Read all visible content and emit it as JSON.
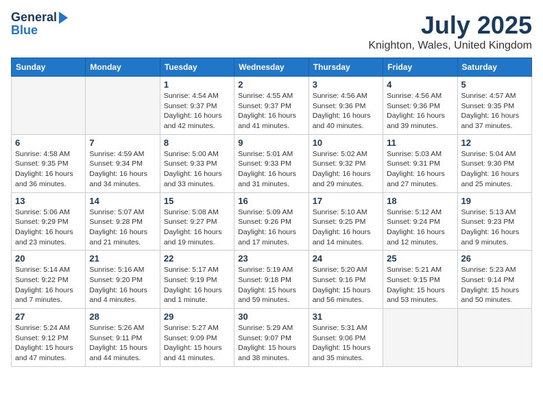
{
  "header": {
    "logo_line1": "General",
    "logo_line2": "Blue",
    "month": "July 2025",
    "location": "Knighton, Wales, United Kingdom"
  },
  "weekdays": [
    "Sunday",
    "Monday",
    "Tuesday",
    "Wednesday",
    "Thursday",
    "Friday",
    "Saturday"
  ],
  "weeks": [
    [
      {
        "day": "",
        "sunrise": "",
        "sunset": "",
        "daylight": ""
      },
      {
        "day": "",
        "sunrise": "",
        "sunset": "",
        "daylight": ""
      },
      {
        "day": "1",
        "sunrise": "Sunrise: 4:54 AM",
        "sunset": "Sunset: 9:37 PM",
        "daylight": "Daylight: 16 hours and 42 minutes."
      },
      {
        "day": "2",
        "sunrise": "Sunrise: 4:55 AM",
        "sunset": "Sunset: 9:37 PM",
        "daylight": "Daylight: 16 hours and 41 minutes."
      },
      {
        "day": "3",
        "sunrise": "Sunrise: 4:56 AM",
        "sunset": "Sunset: 9:36 PM",
        "daylight": "Daylight: 16 hours and 40 minutes."
      },
      {
        "day": "4",
        "sunrise": "Sunrise: 4:56 AM",
        "sunset": "Sunset: 9:36 PM",
        "daylight": "Daylight: 16 hours and 39 minutes."
      },
      {
        "day": "5",
        "sunrise": "Sunrise: 4:57 AM",
        "sunset": "Sunset: 9:35 PM",
        "daylight": "Daylight: 16 hours and 37 minutes."
      }
    ],
    [
      {
        "day": "6",
        "sunrise": "Sunrise: 4:58 AM",
        "sunset": "Sunset: 9:35 PM",
        "daylight": "Daylight: 16 hours and 36 minutes."
      },
      {
        "day": "7",
        "sunrise": "Sunrise: 4:59 AM",
        "sunset": "Sunset: 9:34 PM",
        "daylight": "Daylight: 16 hours and 34 minutes."
      },
      {
        "day": "8",
        "sunrise": "Sunrise: 5:00 AM",
        "sunset": "Sunset: 9:33 PM",
        "daylight": "Daylight: 16 hours and 33 minutes."
      },
      {
        "day": "9",
        "sunrise": "Sunrise: 5:01 AM",
        "sunset": "Sunset: 9:33 PM",
        "daylight": "Daylight: 16 hours and 31 minutes."
      },
      {
        "day": "10",
        "sunrise": "Sunrise: 5:02 AM",
        "sunset": "Sunset: 9:32 PM",
        "daylight": "Daylight: 16 hours and 29 minutes."
      },
      {
        "day": "11",
        "sunrise": "Sunrise: 5:03 AM",
        "sunset": "Sunset: 9:31 PM",
        "daylight": "Daylight: 16 hours and 27 minutes."
      },
      {
        "day": "12",
        "sunrise": "Sunrise: 5:04 AM",
        "sunset": "Sunset: 9:30 PM",
        "daylight": "Daylight: 16 hours and 25 minutes."
      }
    ],
    [
      {
        "day": "13",
        "sunrise": "Sunrise: 5:06 AM",
        "sunset": "Sunset: 9:29 PM",
        "daylight": "Daylight: 16 hours and 23 minutes."
      },
      {
        "day": "14",
        "sunrise": "Sunrise: 5:07 AM",
        "sunset": "Sunset: 9:28 PM",
        "daylight": "Daylight: 16 hours and 21 minutes."
      },
      {
        "day": "15",
        "sunrise": "Sunrise: 5:08 AM",
        "sunset": "Sunset: 9:27 PM",
        "daylight": "Daylight: 16 hours and 19 minutes."
      },
      {
        "day": "16",
        "sunrise": "Sunrise: 5:09 AM",
        "sunset": "Sunset: 9:26 PM",
        "daylight": "Daylight: 16 hours and 17 minutes."
      },
      {
        "day": "17",
        "sunrise": "Sunrise: 5:10 AM",
        "sunset": "Sunset: 9:25 PM",
        "daylight": "Daylight: 16 hours and 14 minutes."
      },
      {
        "day": "18",
        "sunrise": "Sunrise: 5:12 AM",
        "sunset": "Sunset: 9:24 PM",
        "daylight": "Daylight: 16 hours and 12 minutes."
      },
      {
        "day": "19",
        "sunrise": "Sunrise: 5:13 AM",
        "sunset": "Sunset: 9:23 PM",
        "daylight": "Daylight: 16 hours and 9 minutes."
      }
    ],
    [
      {
        "day": "20",
        "sunrise": "Sunrise: 5:14 AM",
        "sunset": "Sunset: 9:22 PM",
        "daylight": "Daylight: 16 hours and 7 minutes."
      },
      {
        "day": "21",
        "sunrise": "Sunrise: 5:16 AM",
        "sunset": "Sunset: 9:20 PM",
        "daylight": "Daylight: 16 hours and 4 minutes."
      },
      {
        "day": "22",
        "sunrise": "Sunrise: 5:17 AM",
        "sunset": "Sunset: 9:19 PM",
        "daylight": "Daylight: 16 hours and 1 minute."
      },
      {
        "day": "23",
        "sunrise": "Sunrise: 5:19 AM",
        "sunset": "Sunset: 9:18 PM",
        "daylight": "Daylight: 15 hours and 59 minutes."
      },
      {
        "day": "24",
        "sunrise": "Sunrise: 5:20 AM",
        "sunset": "Sunset: 9:16 PM",
        "daylight": "Daylight: 15 hours and 56 minutes."
      },
      {
        "day": "25",
        "sunrise": "Sunrise: 5:21 AM",
        "sunset": "Sunset: 9:15 PM",
        "daylight": "Daylight: 15 hours and 53 minutes."
      },
      {
        "day": "26",
        "sunrise": "Sunrise: 5:23 AM",
        "sunset": "Sunset: 9:14 PM",
        "daylight": "Daylight: 15 hours and 50 minutes."
      }
    ],
    [
      {
        "day": "27",
        "sunrise": "Sunrise: 5:24 AM",
        "sunset": "Sunset: 9:12 PM",
        "daylight": "Daylight: 15 hours and 47 minutes."
      },
      {
        "day": "28",
        "sunrise": "Sunrise: 5:26 AM",
        "sunset": "Sunset: 9:11 PM",
        "daylight": "Daylight: 15 hours and 44 minutes."
      },
      {
        "day": "29",
        "sunrise": "Sunrise: 5:27 AM",
        "sunset": "Sunset: 9:09 PM",
        "daylight": "Daylight: 15 hours and 41 minutes."
      },
      {
        "day": "30",
        "sunrise": "Sunrise: 5:29 AM",
        "sunset": "Sunset: 9:07 PM",
        "daylight": "Daylight: 15 hours and 38 minutes."
      },
      {
        "day": "31",
        "sunrise": "Sunrise: 5:31 AM",
        "sunset": "Sunset: 9:06 PM",
        "daylight": "Daylight: 15 hours and 35 minutes."
      },
      {
        "day": "",
        "sunrise": "",
        "sunset": "",
        "daylight": ""
      },
      {
        "day": "",
        "sunrise": "",
        "sunset": "",
        "daylight": ""
      }
    ]
  ]
}
